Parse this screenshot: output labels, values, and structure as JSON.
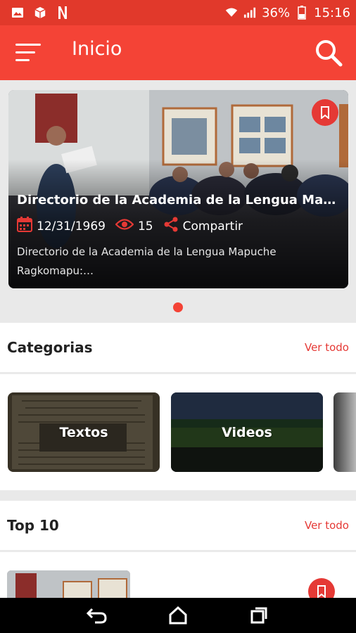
{
  "status_bar": {
    "battery": "36%",
    "time": "15:16",
    "notification_icons": [
      "image-icon",
      "package-icon",
      "netflix-icon"
    ],
    "system_icons": [
      "wifi-icon",
      "signal-icon",
      "battery-icon"
    ]
  },
  "app_bar": {
    "title": "Inicio",
    "menu_icon": "hamburger-menu-icon",
    "search_icon": "search-icon"
  },
  "featured": {
    "title": "Directorio de la Academia de la Lengua Ma…",
    "date": "12/31/1969",
    "views": "15",
    "share_label": "Compartir",
    "description": "Directorio de la Academia de la Lengua Mapuche Ragkomapu:…"
  },
  "categories": {
    "title": "Categorias",
    "see_all": "Ver todo",
    "items": [
      {
        "label": "Textos"
      },
      {
        "label": "Videos"
      }
    ]
  },
  "top10": {
    "title": "Top 10",
    "see_all": "Ver todo"
  },
  "colors": {
    "primary": "#f44336",
    "status_bar": "#e1392b",
    "accent": "#e53935"
  }
}
